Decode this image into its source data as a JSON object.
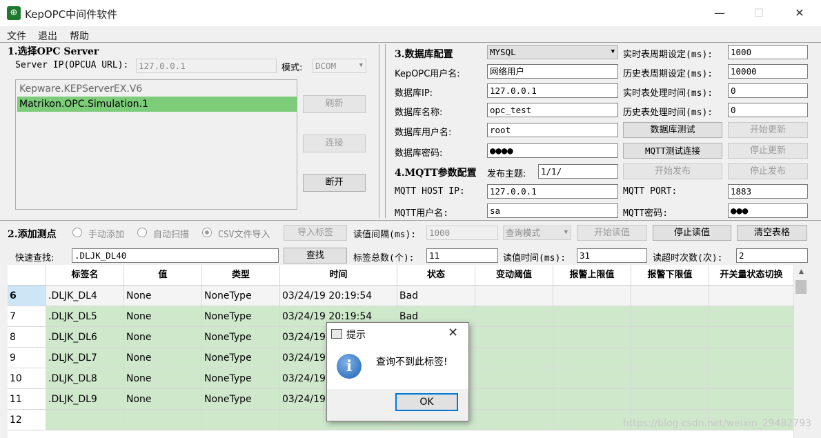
{
  "window": {
    "title": "KepOPC中间件软件",
    "minimize": "—",
    "maximize": "☐",
    "close": "✕"
  },
  "menu": [
    "文件",
    "退出",
    "帮助"
  ],
  "opc": {
    "section_title": "1.选择OPC Server",
    "server_ip_label": "Server IP(OPCUA URL):",
    "server_ip_value": "127.0.0.1",
    "mode_label": "模式:",
    "mode_value": "DCOM",
    "servers": [
      "Kepware.KEPServerEX.V6",
      "Matrikon.OPC.Simulation.1"
    ],
    "selected_index": 1,
    "refresh": "刷新",
    "connect": "连接",
    "disconnect": "断开"
  },
  "db": {
    "section_title": "3.数据库配置",
    "db_type": "MYSQL",
    "user_label": "KepOPC用户名:",
    "user_value": "网络用户",
    "ip_label": "数据库IP:",
    "ip_value": "127.0.0.1",
    "name_label": "数据库名称:",
    "name_value": "opc_test",
    "dbuser_label": "数据库用户名:",
    "dbuser_value": "root",
    "pwd_label": "数据库密码:",
    "pwd_value": "●●●●",
    "rt_period_label": "实时表周期设定(ms):",
    "rt_period_value": "1000",
    "hist_period_label": "历史表周期设定(ms):",
    "hist_period_value": "10000",
    "rt_proc_label": "实时表处理时间(ms):",
    "rt_proc_value": "0",
    "hist_proc_label": "历史表处理时间(ms):",
    "hist_proc_value": "0",
    "test_db": "数据库测试",
    "start_update": "开始更新",
    "test_mqtt": "MQTT测试连接",
    "stop_update": "停止更新"
  },
  "mqtt": {
    "section_title": "4.MQTT参数配置",
    "topic_label": "发布主题:",
    "topic_value": "1/1/",
    "start_publish": "开始发布",
    "stop_publish": "停止发布",
    "host_label": "MQTT HOST IP:",
    "host_value": "127.0.0.1",
    "port_label": "MQTT PORT:",
    "port_value": "1883",
    "user_label": "MQTT用户名:",
    "user_value": "sa",
    "pwd_label": "MQTT密码:",
    "pwd_value": "●●●"
  },
  "points": {
    "section_title": "2.添加测点",
    "manual": "手动添加",
    "auto": "自动扫描",
    "csv": "CSV文件导入",
    "import_tags": "导入标签",
    "interval_label": "读值间隔(ms):",
    "interval_value": "1000",
    "query_mode": "查询模式",
    "start_read": "开始读值",
    "stop_read": "停止读值",
    "clear_table": "清空表格",
    "search_label": "快速查找:",
    "search_value": ".DLJK_DL40",
    "search_btn": "查找",
    "total_label": "标签总数(个):",
    "total_value": "11",
    "read_time_label": "读值时间(ms):",
    "read_time_value": "31",
    "timeout_label": "读超时次数(次):",
    "timeout_value": "2"
  },
  "grid": {
    "columns": [
      "标签名",
      "值",
      "类型",
      "时间",
      "状态",
      "变动阈值",
      "报警上限值",
      "报警下限值",
      "开关量状态切换"
    ],
    "rows": [
      {
        "num": "6",
        "tag": ".DLJK_DL4",
        "value": "None",
        "type": "NoneType",
        "time": "03/24/19 20:19:54",
        "status": "Bad"
      },
      {
        "num": "7",
        "tag": ".DLJK_DL5",
        "value": "None",
        "type": "NoneType",
        "time": "03/24/19 20:19:54",
        "status": "Bad"
      },
      {
        "num": "8",
        "tag": ".DLJK_DL6",
        "value": "None",
        "type": "NoneType",
        "time": "03/24/19",
        "status": ""
      },
      {
        "num": "9",
        "tag": ".DLJK_DL7",
        "value": "None",
        "type": "NoneType",
        "time": "03/24/19",
        "status": ""
      },
      {
        "num": "10",
        "tag": ".DLJK_DL8",
        "value": "None",
        "type": "NoneType",
        "time": "03/24/19",
        "status": ""
      },
      {
        "num": "11",
        "tag": ".DLJK_DL9",
        "value": "None",
        "type": "NoneType",
        "time": "03/24/19",
        "status": ""
      },
      {
        "num": "12",
        "tag": "",
        "value": "",
        "type": "",
        "time": "",
        "status": ""
      }
    ]
  },
  "dialog": {
    "title": "提示",
    "message": "查询不到此标签!",
    "ok": "OK",
    "close": "✕"
  },
  "watermark": "https://blog.csdn.net/weixin_29482793"
}
